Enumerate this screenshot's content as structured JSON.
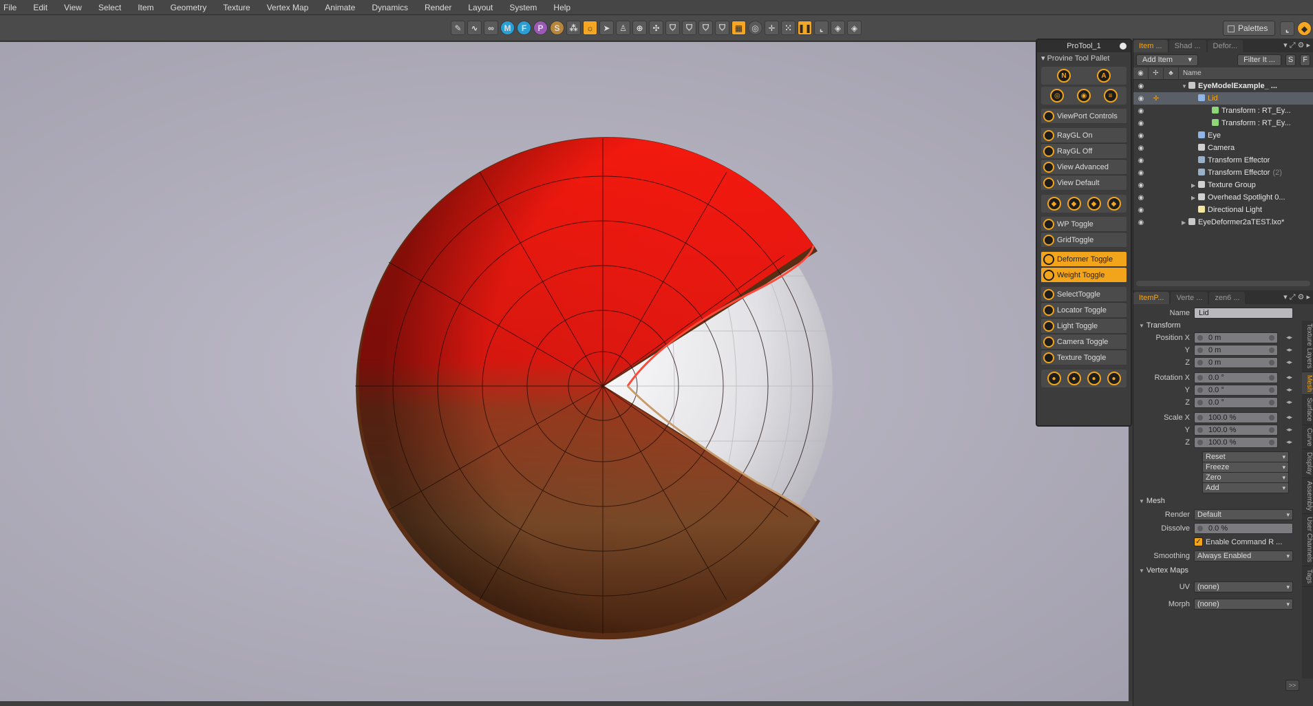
{
  "menu": [
    "File",
    "Edit",
    "View",
    "Select",
    "Item",
    "Geometry",
    "Texture",
    "Vertex Map",
    "Animate",
    "Dynamics",
    "Render",
    "Layout",
    "System",
    "Help"
  ],
  "toolbar": {
    "icons": [
      {
        "name": "sketch-icon",
        "glyph": "✎"
      },
      {
        "name": "curve-icon",
        "glyph": "∿"
      },
      {
        "name": "link-icon",
        "glyph": "∞"
      },
      {
        "name": "m-icon",
        "glyph": "M"
      },
      {
        "name": "f-icon",
        "glyph": "F"
      },
      {
        "name": "p-icon",
        "glyph": "P"
      },
      {
        "name": "s-icon",
        "glyph": "S"
      },
      {
        "name": "wand-icon",
        "glyph": "⁂"
      },
      {
        "name": "sun-icon",
        "glyph": "☼"
      },
      {
        "name": "pointer-icon",
        "glyph": "➤"
      },
      {
        "name": "figure-icon",
        "glyph": "♙"
      },
      {
        "name": "target-icon",
        "glyph": "⊕"
      },
      {
        "name": "move-icon",
        "glyph": "✣"
      },
      {
        "name": "shield-icon-1",
        "glyph": "⛉"
      },
      {
        "name": "shield-icon-2",
        "glyph": "⛉"
      },
      {
        "name": "shield-icon-3",
        "glyph": "⛉"
      },
      {
        "name": "shield-icon-4",
        "glyph": "⛉"
      },
      {
        "name": "grid-orange-icon",
        "glyph": "▦"
      },
      {
        "name": "ring-icon",
        "glyph": "◎"
      },
      {
        "name": "crosshair-icon",
        "glyph": "✛"
      },
      {
        "name": "dots-icon",
        "glyph": "⁙"
      },
      {
        "name": "pause-icon",
        "glyph": "❚❚"
      },
      {
        "name": "corner-icon",
        "glyph": "⌞"
      },
      {
        "name": "cube-icon",
        "glyph": "◈"
      },
      {
        "name": "cube2-icon",
        "glyph": "◈"
      }
    ],
    "palettes_label": "Palettes"
  },
  "protool": {
    "title": "ProTool_1",
    "subtitle": "Provine  Tool  Pallet",
    "row1_icons": [
      "N",
      "A"
    ],
    "row2_icons": [
      "◎",
      "◉",
      "≡"
    ],
    "viewport_group": [
      "ViewPort Controls"
    ],
    "ray_group": [
      "RayGL On",
      "RayGL Off",
      "View Advanced",
      "View Default"
    ],
    "row3_icons": [
      "◆",
      "◆",
      "◆",
      "◆"
    ],
    "wp_group": [
      "WP Toggle",
      "GridToggle"
    ],
    "deformer_group": [
      "Deformer Toggle",
      "Weight Toggle"
    ],
    "select_group": [
      "SelectToggle",
      "Locator Toggle",
      "Light Toggle",
      "Camera Toggle",
      "Texture Toggle"
    ],
    "row4_icons": [
      "●",
      "●",
      "●",
      "●"
    ]
  },
  "items_panel": {
    "tabs": [
      "Item ...",
      "Shad ...",
      "Defor..."
    ],
    "add_item": "Add Item",
    "filter": "Filter It ...",
    "column_name": "Name",
    "rows": [
      {
        "label": "EyeModelExample_ ...",
        "indent": 70,
        "icon": "#c9c9c9",
        "exp": "▼",
        "bold": true
      },
      {
        "label": "Lid",
        "indent": 84,
        "icon": "#8fb4e6",
        "exp": "",
        "selected": true
      },
      {
        "label": "Transform : RT_Ey...",
        "indent": 104,
        "icon": "#8fd67a",
        "exp": ""
      },
      {
        "label": "Transform : RT_Ey...",
        "indent": 104,
        "icon": "#8fd67a",
        "exp": ""
      },
      {
        "label": "Eye",
        "indent": 84,
        "icon": "#8fb4e6",
        "exp": ""
      },
      {
        "label": "Camera",
        "indent": 84,
        "icon": "#cfcfcf",
        "exp": ""
      },
      {
        "label": "Transform Effector",
        "indent": 84,
        "icon": "#9ab0c8",
        "exp": ""
      },
      {
        "label": "Transform Effector",
        "suffix": "(2)",
        "indent": 84,
        "icon": "#9ab0c8",
        "exp": ""
      },
      {
        "label": "Texture Group",
        "indent": 84,
        "icon": "#cfcfcf",
        "exp": "▶"
      },
      {
        "label": "Overhead Spotlight 0...",
        "indent": 84,
        "icon": "#cfcfcf",
        "exp": "▶"
      },
      {
        "label": "Directional Light",
        "indent": 84,
        "icon": "#f2e6a0",
        "exp": ""
      },
      {
        "label": "EyeDeformer2aTEST.lxo*",
        "indent": 70,
        "icon": "#c9c9c9",
        "exp": "▶"
      }
    ]
  },
  "props_panel": {
    "tabs": [
      "ItemP...",
      "Verte ...",
      "zen6 ..."
    ],
    "name_label": "Name",
    "name_value": "Lid",
    "transform_head": "Transform",
    "rows": [
      {
        "label": "Position X",
        "value": "0 m"
      },
      {
        "label": "Y",
        "value": "0 m"
      },
      {
        "label": "Z",
        "value": "0 m"
      },
      {
        "label": "Rotation X",
        "value": "0.0 °"
      },
      {
        "label": "Y",
        "value": "0.0 °"
      },
      {
        "label": "Z",
        "value": "0.0 °"
      },
      {
        "label": "Scale X",
        "value": "100.0 %"
      },
      {
        "label": "Y",
        "value": "100.0 %"
      },
      {
        "label": "Z",
        "value": "100.0 %"
      }
    ],
    "actions": [
      "Reset",
      "Freeze",
      "Zero",
      "Add"
    ],
    "mesh_head": "Mesh",
    "render_label": "Render",
    "render_value": "Default",
    "dissolve_label": "Dissolve",
    "dissolve_value": "0.0 %",
    "enable_command": "Enable Command R ...",
    "smoothing_label": "Smoothing",
    "smoothing_value": "Always Enabled",
    "vmaps_head": "Vertex Maps",
    "uv_label": "UV",
    "uv_value": "(none)",
    "morph_label": "Morph",
    "morph_value": "(none)",
    "side_tabs": [
      "Texture Layers",
      "Mesh",
      "Surface",
      "Curve",
      "Display",
      "Assembly",
      "User Channels",
      "Tags"
    ],
    "expand": ">>"
  },
  "colors": {
    "accent": "#f2a51a",
    "lid_red": "#ff1a0f",
    "lid_brown": "#8a5a2e",
    "eye_white": "#e8e8ec"
  }
}
